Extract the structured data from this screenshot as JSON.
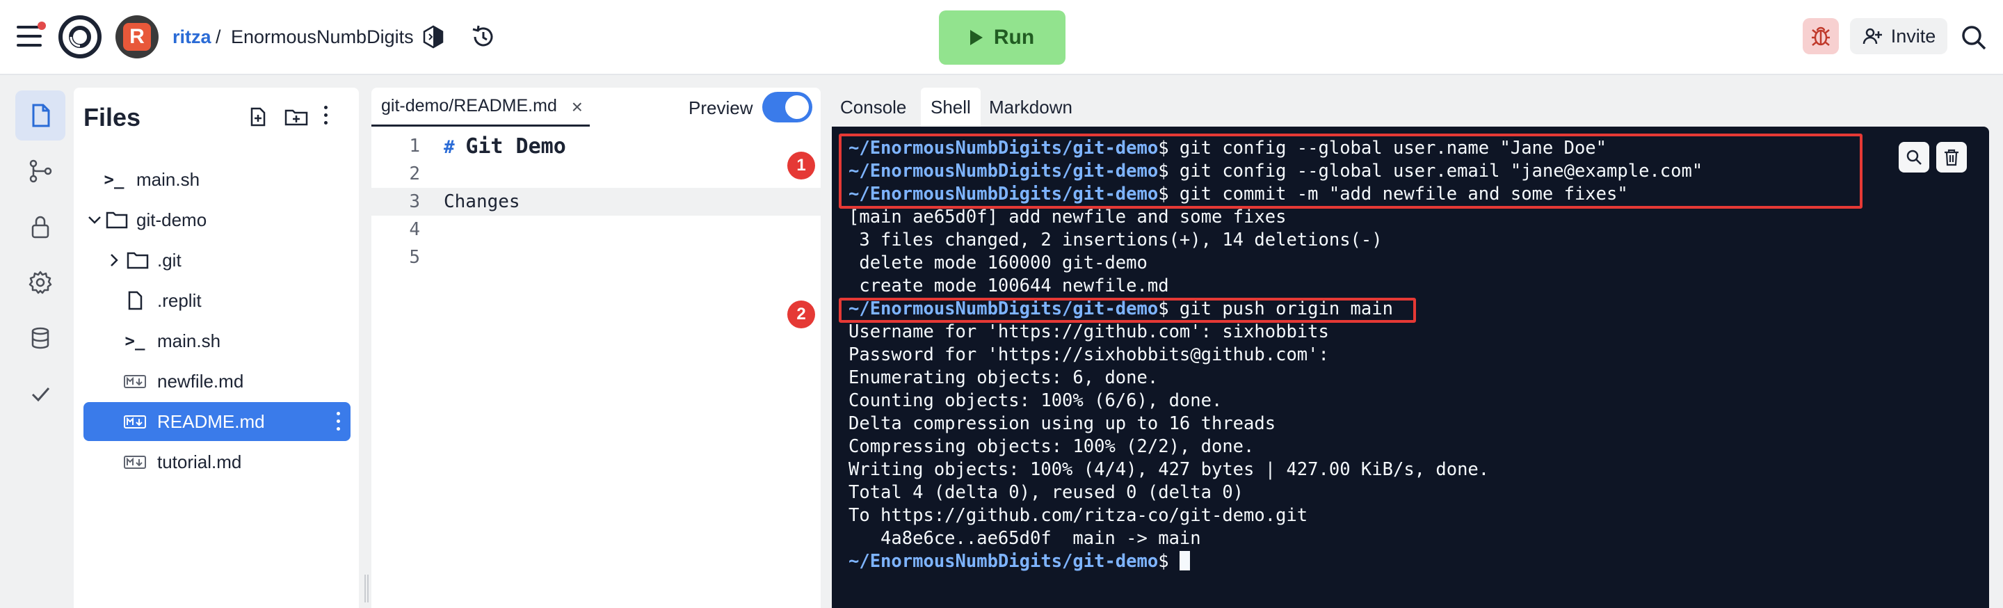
{
  "header": {
    "owner": "ritza",
    "separator": "/",
    "repl_name": "EnormousNumbDigits",
    "run_label": "Run",
    "invite_label": "Invite",
    "avatar_letter": "R"
  },
  "rail": {
    "items": [
      "files-icon",
      "git-icon",
      "secrets-icon",
      "settings-icon",
      "database-icon",
      "check-icon"
    ]
  },
  "files": {
    "title": "Files",
    "items": [
      {
        "label": "main.sh",
        "type": "shell"
      },
      {
        "label": "git-demo",
        "type": "folder-open"
      },
      {
        "label": ".git",
        "type": "folder-closed"
      },
      {
        "label": ".replit",
        "type": "file"
      },
      {
        "label": "main.sh",
        "type": "shell"
      },
      {
        "label": "newfile.md",
        "type": "markdown"
      },
      {
        "label": "README.md",
        "type": "markdown",
        "selected": true
      },
      {
        "label": "tutorial.md",
        "type": "markdown"
      }
    ]
  },
  "editor": {
    "tab_label": "git-demo/README.md",
    "close_glyph": "×",
    "preview_label": "Preview",
    "preview_on": true,
    "lines": [
      {
        "num": "1",
        "hash": "#",
        "text": "Git Demo"
      },
      {
        "num": "2",
        "text": ""
      },
      {
        "num": "3",
        "text": "Changes"
      },
      {
        "num": "4",
        "text": ""
      },
      {
        "num": "5",
        "text": ""
      }
    ]
  },
  "console": {
    "tabs": [
      "Console",
      "Shell",
      "Markdown"
    ],
    "active_tab": "Shell",
    "lines": [
      {
        "prompt": "~/EnormousNumbDigits/git-demo",
        "text": "$ git config --global user.name \"Jane Doe\""
      },
      {
        "prompt": "~/EnormousNumbDigits/git-demo",
        "text": "$ git config --global user.email \"jane@example.com\""
      },
      {
        "prompt": "~/EnormousNumbDigits/git-demo",
        "text": "$ git commit -m \"add newfile and some fixes\""
      },
      {
        "text": "[main ae65d0f] add newfile and some fixes"
      },
      {
        "text": " 3 files changed, 2 insertions(+), 14 deletions(-)"
      },
      {
        "text": " delete mode 160000 git-demo"
      },
      {
        "text": " create mode 100644 newfile.md"
      },
      {
        "prompt": "~/EnormousNumbDigits/git-demo",
        "text": "$ git push origin main"
      },
      {
        "text": "Username for 'https://github.com': sixhobbits"
      },
      {
        "text": "Password for 'https://sixhobbits@github.com':"
      },
      {
        "text": "Enumerating objects: 6, done."
      },
      {
        "text": "Counting objects: 100% (6/6), done."
      },
      {
        "text": "Delta compression using up to 16 threads"
      },
      {
        "text": "Compressing objects: 100% (2/2), done."
      },
      {
        "text": "Writing objects: 100% (4/4), 427 bytes | 427.00 KiB/s, done."
      },
      {
        "text": "Total 4 (delta 0), reused 0 (delta 0)"
      },
      {
        "text": "To https://github.com/ritza-co/git-demo.git"
      },
      {
        "text": "   4a8e6ce..ae65d0f  main -> main"
      },
      {
        "prompt": "~/EnormousNumbDigits/git-demo",
        "text": "$ ",
        "cursor": true
      }
    ]
  },
  "annotations": {
    "badge_1": "1",
    "badge_2": "2"
  },
  "colors": {
    "accent": "#3a7bea",
    "run_bg": "#92e38e",
    "terminal_bg": "#0e1525",
    "prompt": "#7eb4ff",
    "highlight": "#e53935"
  }
}
